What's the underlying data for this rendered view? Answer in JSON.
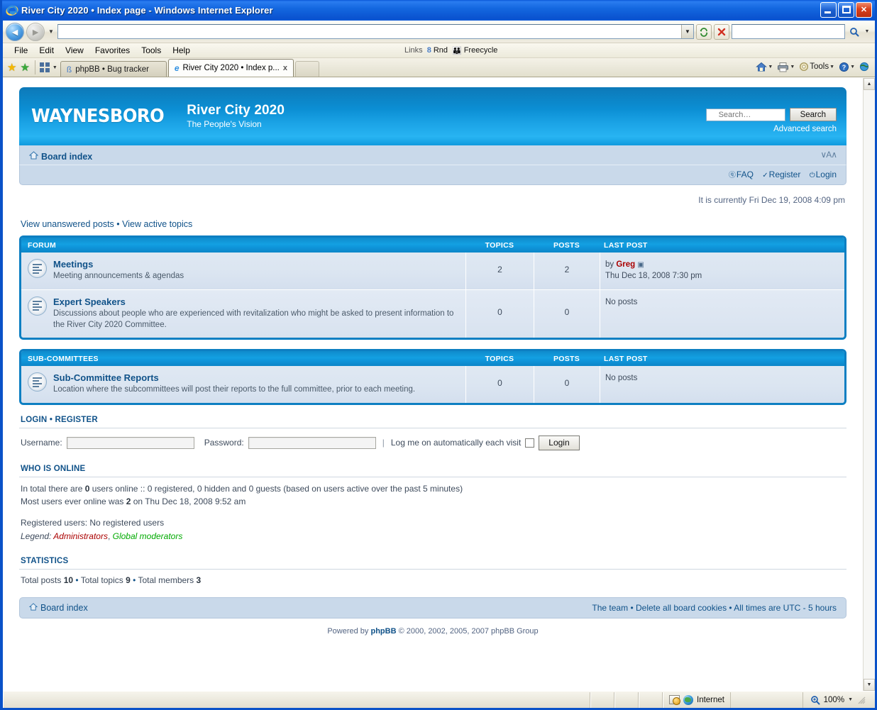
{
  "browser": {
    "window_title": "River City 2020 • Index page - Windows Internet Explorer",
    "back_label": "Back",
    "forward_label": "Forward",
    "address_value": "",
    "refresh_label": "Refresh",
    "stop_label": "Stop",
    "search_value": "",
    "search_go_label": "Search",
    "menus": [
      "File",
      "Edit",
      "View",
      "Favorites",
      "Tools",
      "Help"
    ],
    "links_label": "Links",
    "link_items": [
      "Rnd",
      "Freecycle"
    ],
    "tabs": [
      {
        "label": "phpBB • Bug tracker",
        "active": false
      },
      {
        "label": "River City 2020 • Index p...",
        "active": true
      },
      {
        "label": "",
        "active": false
      }
    ],
    "tab_close_label": "x",
    "toolbar_right": [
      "Home",
      "Print",
      "Tools",
      "Help",
      "Feeds"
    ],
    "tools_label": "Tools",
    "status_zone": "Internet",
    "status_zoom": "100%"
  },
  "forum": {
    "logo": "WAYNESBORO",
    "site_title": "River City 2020",
    "site_tagline": "The People's Vision",
    "search": {
      "placeholder": "Search…",
      "value": "",
      "button_label": "Search",
      "advanced_label": "Advanced search"
    },
    "breadcrumb": "Board index",
    "font_sizer": "∨A∧",
    "nav_links": [
      {
        "label": "FAQ",
        "icon": "question-icon"
      },
      {
        "label": "Register",
        "icon": "register-icon"
      },
      {
        "label": "Login",
        "icon": "power-icon"
      }
    ],
    "current_time": "It is currently Fri Dec 19, 2008 4:09 pm",
    "top_links": [
      "View unanswered posts",
      "View active topics"
    ],
    "separator": "•",
    "columns": {
      "forum": "FORUM",
      "topics": "TOPICS",
      "posts": "POSTS",
      "last_post": "LAST POST"
    },
    "sections": [
      {
        "header": "FORUM",
        "rows": [
          {
            "title": "Meetings",
            "description": "Meeting announcements & agendas",
            "topics": "2",
            "posts": "2",
            "last_post_prefix": "by",
            "last_post_author": "Greg",
            "last_post_date": "Thu Dec 18, 2008 7:30 pm",
            "no_posts": ""
          },
          {
            "title": "Expert Speakers",
            "description": "Discussions about people who are experienced with revitalization who might be asked to present information to the River City 2020 Committee.",
            "topics": "0",
            "posts": "0",
            "last_post_prefix": "",
            "last_post_author": "",
            "last_post_date": "",
            "no_posts": "No posts"
          }
        ]
      },
      {
        "header": "SUB-COMMITTEES",
        "rows": [
          {
            "title": "Sub-Committee Reports",
            "description": "Location where the subcommittees will post their reports to the full committee, prior to each meeting.",
            "topics": "0",
            "posts": "0",
            "last_post_prefix": "",
            "last_post_author": "",
            "last_post_date": "",
            "no_posts": "No posts"
          }
        ]
      }
    ],
    "login_block": {
      "heading_login": "LOGIN",
      "heading_register": "REGISTER",
      "username_label": "Username:",
      "username_value": "",
      "password_label": "Password:",
      "password_value": "",
      "autologin_label": "Log me on automatically each visit",
      "autologin_checked": false,
      "login_button": "Login"
    },
    "who_is_online": {
      "heading": "WHO IS ONLINE",
      "line1_a": "In total there are ",
      "line1_count": "0",
      "line1_b": " users online :: 0 registered, 0 hidden and 0 guests (based on users active over the past 5 minutes)",
      "line2_a": "Most users ever online was ",
      "line2_count": "2",
      "line2_b": " on Thu Dec 18, 2008 9:52 am",
      "registered_users": "Registered users: No registered users",
      "legend_label": "Legend: ",
      "legend_admins": "Administrators",
      "legend_comma": ", ",
      "legend_mods": "Global moderators"
    },
    "statistics": {
      "heading": "STATISTICS",
      "total_posts_label": "Total posts ",
      "total_posts": "10",
      "total_topics_label": "Total topics ",
      "total_topics": "9",
      "total_members_label": "Total members ",
      "total_members": "3"
    },
    "footer": {
      "board_index": "Board index",
      "the_team": "The team",
      "delete_cookies": "Delete all board cookies",
      "timezone": "All times are UTC - 5 hours",
      "powered_a": "Powered by ",
      "powered_brand": "phpBB",
      "powered_b": " © 2000, 2002, 2005, 2007 phpBB Group"
    }
  },
  "colors": {
    "header_blue": "#0f97dc",
    "link_blue": "#105289",
    "admin_red": "#aa0000",
    "mod_green": "#00aa00",
    "panel_blue": "#c9d9ea"
  }
}
